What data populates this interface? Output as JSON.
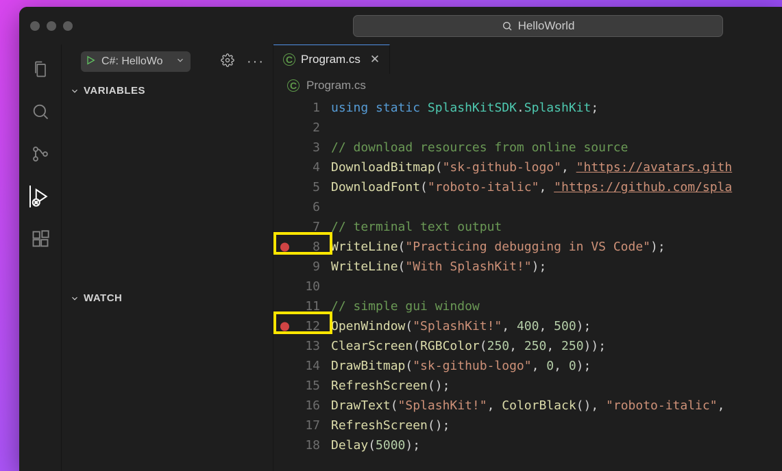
{
  "titlebar": {
    "search_text": "HelloWorld"
  },
  "debug": {
    "config_label": "C#: HelloWo",
    "sections": {
      "variables": "VARIABLES",
      "watch": "WATCH"
    }
  },
  "editor": {
    "tab_label": "Program.cs",
    "breadcrumb": "Program.cs",
    "breakpoint_lines": [
      8,
      12
    ],
    "lines": [
      {
        "n": 1,
        "tokens": [
          [
            "kw",
            "using"
          ],
          [
            "punc",
            " "
          ],
          [
            "kw",
            "static"
          ],
          [
            "punc",
            " "
          ],
          [
            "type",
            "SplashKitSDK"
          ],
          [
            "punc",
            "."
          ],
          [
            "type",
            "SplashKit"
          ],
          [
            "punc",
            ";"
          ]
        ]
      },
      {
        "n": 2,
        "tokens": []
      },
      {
        "n": 3,
        "tokens": [
          [
            "com",
            "// download resources from online source"
          ]
        ]
      },
      {
        "n": 4,
        "tokens": [
          [
            "fn",
            "DownloadBitmap"
          ],
          [
            "punc",
            "("
          ],
          [
            "str",
            "\"sk-github-logo\""
          ],
          [
            "punc",
            ", "
          ],
          [
            "link",
            "\"https://avatars.gith"
          ]
        ]
      },
      {
        "n": 5,
        "tokens": [
          [
            "fn",
            "DownloadFont"
          ],
          [
            "punc",
            "("
          ],
          [
            "str",
            "\"roboto-italic\""
          ],
          [
            "punc",
            ", "
          ],
          [
            "link",
            "\"https://github.com/spla"
          ]
        ]
      },
      {
        "n": 6,
        "tokens": []
      },
      {
        "n": 7,
        "tokens": [
          [
            "com",
            "// terminal text output"
          ]
        ]
      },
      {
        "n": 8,
        "tokens": [
          [
            "fn",
            "WriteLine"
          ],
          [
            "punc",
            "("
          ],
          [
            "str",
            "\"Practicing debugging in VS Code\""
          ],
          [
            "punc",
            ");"
          ]
        ]
      },
      {
        "n": 9,
        "tokens": [
          [
            "fn",
            "WriteLine"
          ],
          [
            "punc",
            "("
          ],
          [
            "str",
            "\"With SplashKit!\""
          ],
          [
            "punc",
            ");"
          ]
        ]
      },
      {
        "n": 10,
        "tokens": []
      },
      {
        "n": 11,
        "tokens": [
          [
            "com",
            "// simple gui window"
          ]
        ]
      },
      {
        "n": 12,
        "tokens": [
          [
            "fn",
            "OpenWindow"
          ],
          [
            "punc",
            "("
          ],
          [
            "str",
            "\"SplashKit!\""
          ],
          [
            "punc",
            ", "
          ],
          [
            "num",
            "400"
          ],
          [
            "punc",
            ", "
          ],
          [
            "num",
            "500"
          ],
          [
            "punc",
            ");"
          ]
        ]
      },
      {
        "n": 13,
        "tokens": [
          [
            "fn",
            "ClearScreen"
          ],
          [
            "punc",
            "("
          ],
          [
            "fn",
            "RGBColor"
          ],
          [
            "punc",
            "("
          ],
          [
            "num",
            "250"
          ],
          [
            "punc",
            ", "
          ],
          [
            "num",
            "250"
          ],
          [
            "punc",
            ", "
          ],
          [
            "num",
            "250"
          ],
          [
            "punc",
            "));"
          ]
        ]
      },
      {
        "n": 14,
        "tokens": [
          [
            "fn",
            "DrawBitmap"
          ],
          [
            "punc",
            "("
          ],
          [
            "str",
            "\"sk-github-logo\""
          ],
          [
            "punc",
            ", "
          ],
          [
            "num",
            "0"
          ],
          [
            "punc",
            ", "
          ],
          [
            "num",
            "0"
          ],
          [
            "punc",
            ");"
          ]
        ]
      },
      {
        "n": 15,
        "tokens": [
          [
            "fn",
            "RefreshScreen"
          ],
          [
            "punc",
            "();"
          ]
        ]
      },
      {
        "n": 16,
        "tokens": [
          [
            "fn",
            "DrawText"
          ],
          [
            "punc",
            "("
          ],
          [
            "str",
            "\"SplashKit!\""
          ],
          [
            "punc",
            ", "
          ],
          [
            "fn",
            "ColorBlack"
          ],
          [
            "punc",
            "(), "
          ],
          [
            "str",
            "\"roboto-italic\""
          ],
          [
            "punc",
            ","
          ]
        ]
      },
      {
        "n": 17,
        "tokens": [
          [
            "fn",
            "RefreshScreen"
          ],
          [
            "punc",
            "();"
          ]
        ]
      },
      {
        "n": 18,
        "tokens": [
          [
            "fn",
            "Delay"
          ],
          [
            "punc",
            "("
          ],
          [
            "num",
            "5000"
          ],
          [
            "punc",
            ");"
          ]
        ]
      }
    ]
  }
}
